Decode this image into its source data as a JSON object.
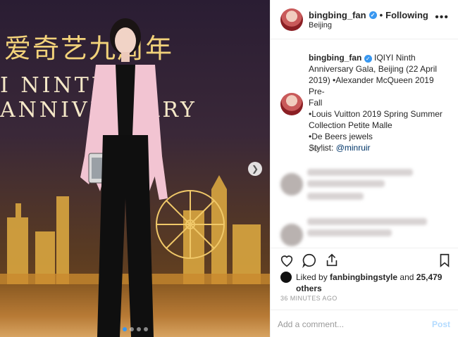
{
  "photo": {
    "banner_cn": "爱奇艺九周年",
    "banner_en": "I NINTH ANNIVERSARY",
    "carousel_dots": 4,
    "active_dot": 0
  },
  "header": {
    "username": "bingbing_fan",
    "separator": "•",
    "follow_label": "Following",
    "location": "Beijing",
    "more_label": "•••"
  },
  "caption": {
    "username": "bingbing_fan",
    "lines": [
      "IQIYI Ninth",
      "Anniversary Gala, Beijing (22 April",
      "2019) •Alexander McQueen 2019 Pre-",
      "Fall",
      "•Louis Vuitton 2019 Spring Summer",
      "Collection Petite Malle",
      "•De Beers jewels"
    ],
    "stylist_label": "Stylist:",
    "stylist_mention": "@minruir",
    "time": "36m"
  },
  "likes": {
    "prefix": "Liked by",
    "user": "fanbingbingstyle",
    "and": "and",
    "count": "25,479 others"
  },
  "posted_ago": "36 MINUTES AGO",
  "comment_box": {
    "placeholder": "Add a comment...",
    "post_label": "Post"
  },
  "colors": {
    "link_blue": "#3897f0",
    "post_disabled": "#b3dbff",
    "muted": "#999999"
  },
  "icons": [
    "heart-icon",
    "comment-icon",
    "share-icon",
    "bookmark-icon",
    "more-icon",
    "verified-icon",
    "chevron-right-icon"
  ]
}
